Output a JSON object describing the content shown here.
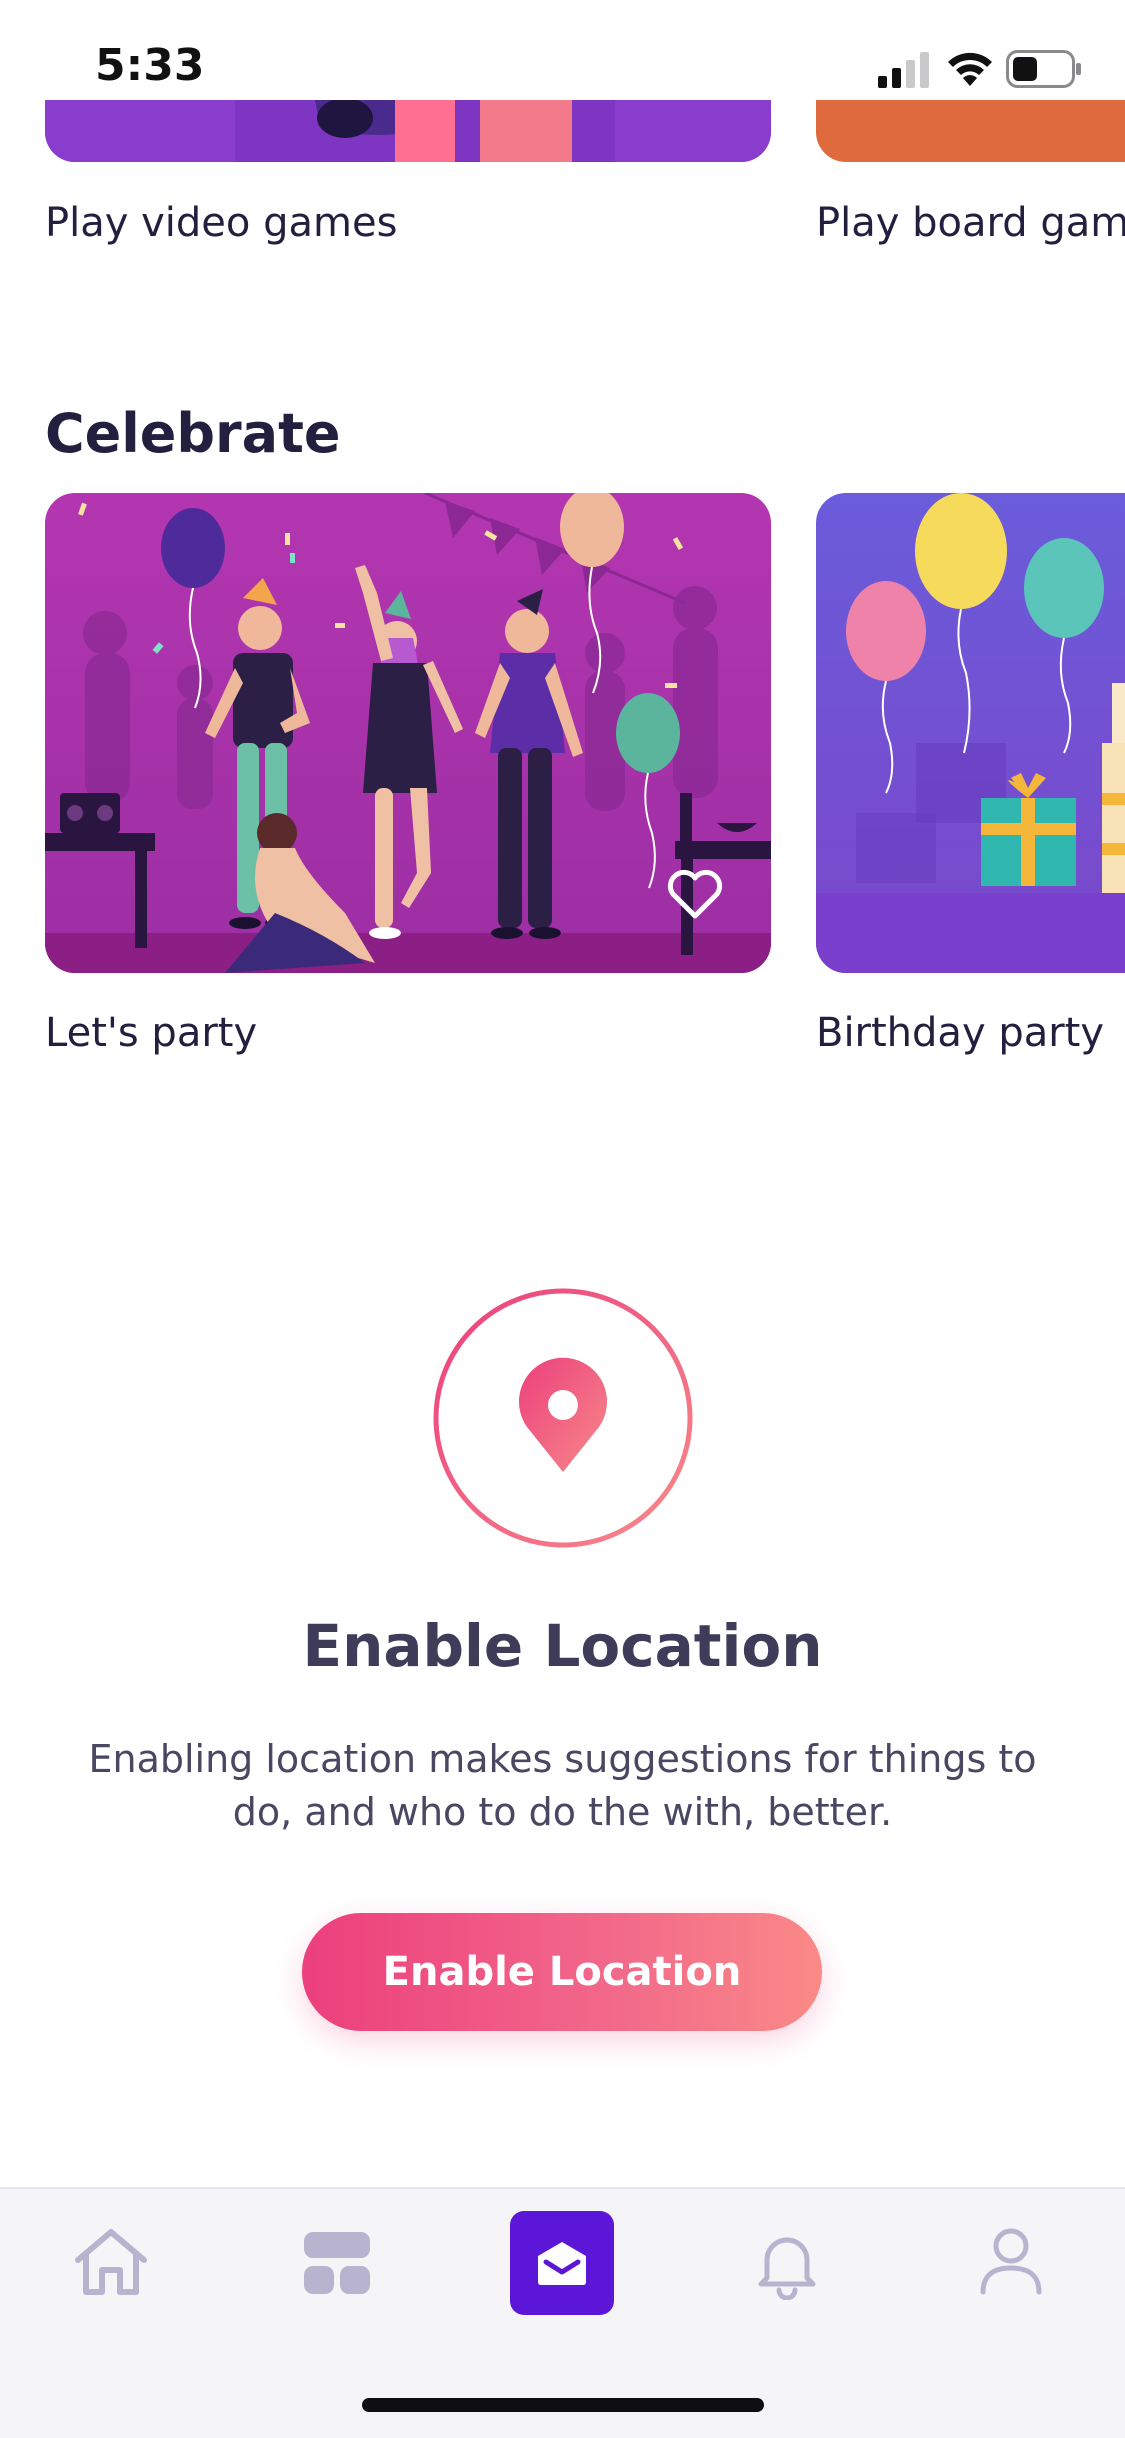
{
  "status_bar": {
    "time": "5:33"
  },
  "top_row": {
    "items": [
      {
        "label": "Play video games"
      },
      {
        "label": "Play board gam"
      }
    ]
  },
  "celebrate": {
    "title": "Celebrate",
    "items": [
      {
        "label": "Let's party"
      },
      {
        "label": "Birthday party"
      }
    ]
  },
  "location": {
    "title": "Enable Location",
    "description_line1": "Enabling location makes suggestions for things to",
    "description_line2": "do, and who to do the with, better.",
    "button_label": "Enable Location"
  },
  "tab_bar": {
    "tabs": [
      {
        "icon": "home-icon"
      },
      {
        "icon": "grid-icon"
      },
      {
        "icon": "inbox-icon",
        "active": true
      },
      {
        "icon": "bell-icon"
      },
      {
        "icon": "profile-icon"
      }
    ],
    "active_color": "#5b16d8",
    "inactive_color": "#b8b3cf"
  },
  "colors": {
    "accent_pink": "#ec3f7c",
    "party_bg": "#a533a9",
    "birthday_bg": "#6b4fd8"
  }
}
